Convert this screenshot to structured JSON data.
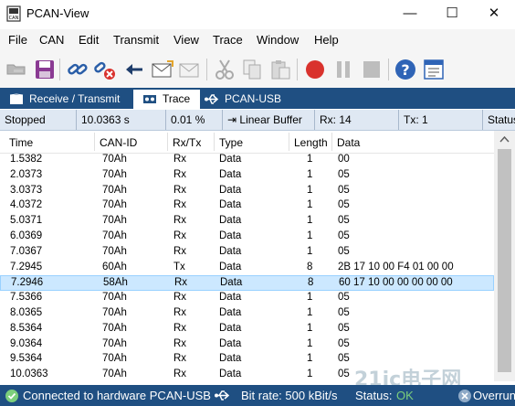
{
  "window": {
    "title": "PCAN-View",
    "minimize": "—",
    "maximize": "☐",
    "close": "✕"
  },
  "menu": [
    "File",
    "CAN",
    "Edit",
    "Transmit",
    "View",
    "Trace",
    "Window",
    "Help"
  ],
  "toolbar": {
    "buttons": [
      "connect-icon",
      "save-icon",
      "link-icon",
      "disconnect-icon",
      "receive-icon",
      "send-mail-icon",
      "mail-icon",
      "cut-icon",
      "copy-icon",
      "paste-icon",
      "record-icon",
      "pause-icon",
      "stop-icon",
      "help-icon",
      "properties-icon"
    ]
  },
  "tabs": [
    {
      "label": "Receive / Transmit",
      "active": false
    },
    {
      "label": "Trace",
      "active": true
    },
    {
      "label": "PCAN-USB",
      "active": false
    }
  ],
  "trace_status": {
    "state": "Stopped",
    "time": "10.0363 s",
    "buffer_pct": "0.01 %",
    "buffer_mode": "Linear Buffer",
    "rx": "Rx: 14",
    "tx": "Tx: 1",
    "status": "Status"
  },
  "columns": [
    "Time",
    "CAN-ID",
    "Rx/Tx",
    "Type",
    "Length",
    "Data"
  ],
  "rows": [
    {
      "time": "1.5382",
      "id": "70Ah",
      "dir": "Rx",
      "type": "Data",
      "len": "1",
      "data": "00"
    },
    {
      "time": "2.0373",
      "id": "70Ah",
      "dir": "Rx",
      "type": "Data",
      "len": "1",
      "data": "05"
    },
    {
      "time": "3.0373",
      "id": "70Ah",
      "dir": "Rx",
      "type": "Data",
      "len": "1",
      "data": "05"
    },
    {
      "time": "4.0372",
      "id": "70Ah",
      "dir": "Rx",
      "type": "Data",
      "len": "1",
      "data": "05"
    },
    {
      "time": "5.0371",
      "id": "70Ah",
      "dir": "Rx",
      "type": "Data",
      "len": "1",
      "data": "05"
    },
    {
      "time": "6.0369",
      "id": "70Ah",
      "dir": "Rx",
      "type": "Data",
      "len": "1",
      "data": "05"
    },
    {
      "time": "7.0367",
      "id": "70Ah",
      "dir": "Rx",
      "type": "Data",
      "len": "1",
      "data": "05"
    },
    {
      "time": "7.2945",
      "id": "60Ah",
      "dir": "Tx",
      "type": "Data",
      "len": "8",
      "data": "2B 17 10 00 F4 01 00 00"
    },
    {
      "time": "7.2946",
      "id": "58Ah",
      "dir": "Rx",
      "type": "Data",
      "len": "8",
      "data": "60 17 10 00 00 00 00 00",
      "selected": true
    },
    {
      "time": "7.5366",
      "id": "70Ah",
      "dir": "Rx",
      "type": "Data",
      "len": "1",
      "data": "05"
    },
    {
      "time": "8.0365",
      "id": "70Ah",
      "dir": "Rx",
      "type": "Data",
      "len": "1",
      "data": "05"
    },
    {
      "time": "8.5364",
      "id": "70Ah",
      "dir": "Rx",
      "type": "Data",
      "len": "1",
      "data": "05"
    },
    {
      "time": "9.0364",
      "id": "70Ah",
      "dir": "Rx",
      "type": "Data",
      "len": "1",
      "data": "05"
    },
    {
      "time": "9.5364",
      "id": "70Ah",
      "dir": "Rx",
      "type": "Data",
      "len": "1",
      "data": "05"
    },
    {
      "time": "10.0363",
      "id": "70Ah",
      "dir": "Rx",
      "type": "Data",
      "len": "1",
      "data": "05"
    }
  ],
  "statusbar": {
    "connection": "Connected to hardware PCAN-USB",
    "bitrate": "Bit rate: 500 kBit/s",
    "status_label": "Status:",
    "status_value": "OK",
    "overrun": "Overrun"
  },
  "watermark": "21ic电子网",
  "colors": {
    "tab_bar": "#1f4f82",
    "selection": "#cce8ff",
    "record": "#d9322d",
    "status_ok": "#7ccf7c"
  }
}
